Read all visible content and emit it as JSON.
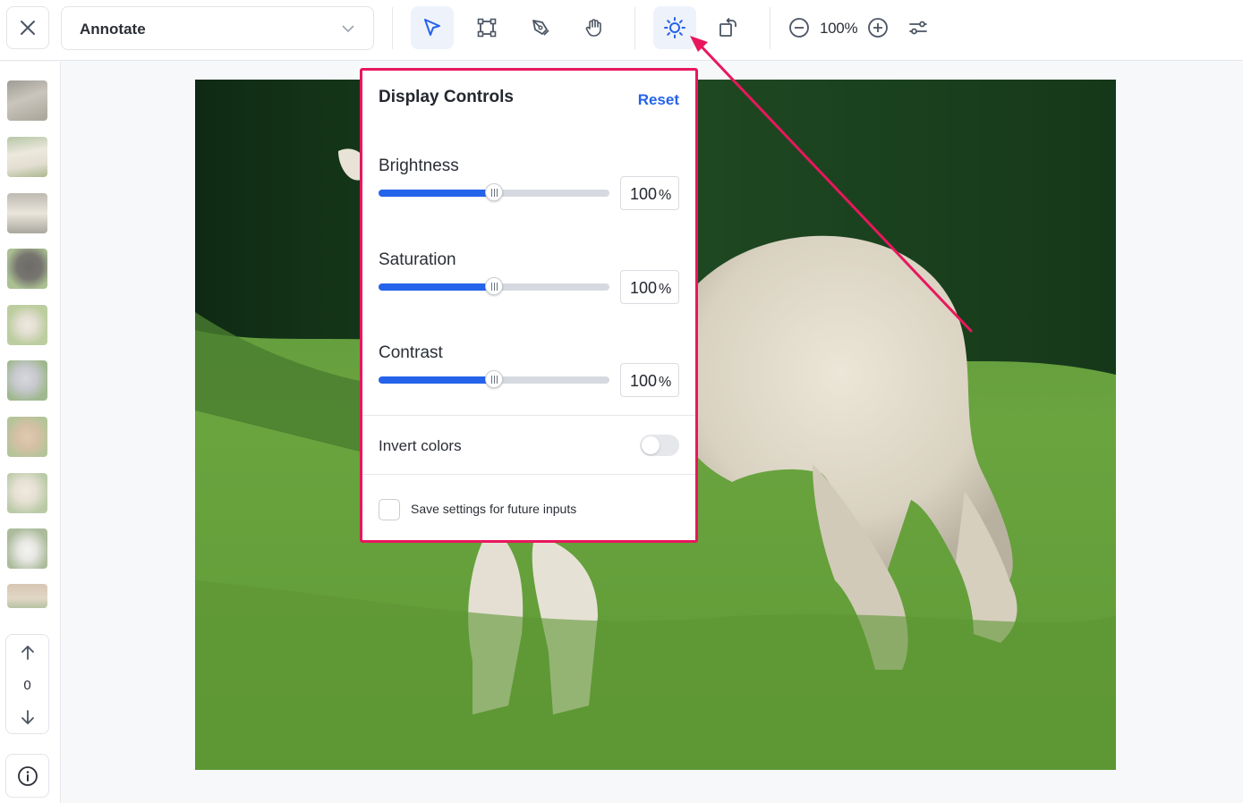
{
  "toolbar": {
    "mode_value": "Annotate",
    "zoom_level": "100%",
    "icons": [
      "close-icon",
      "chevron-down-icon",
      "pointer-icon",
      "bounding-box-icon",
      "pen-icon",
      "hand-icon",
      "brightness-icon",
      "rotate-icon",
      "zoom-out-icon",
      "zoom-in-icon",
      "settings-sliders-icon"
    ],
    "active_tool": "pointer",
    "active_button": "display-controls"
  },
  "sidebar": {
    "thumbnail_count": 10,
    "nav_index": "0",
    "icons": [
      "arrow-up-icon",
      "arrow-down-icon",
      "info-icon"
    ]
  },
  "display_controls": {
    "title": "Display Controls",
    "reset_label": "Reset",
    "controls": [
      {
        "label": "Brightness",
        "value": "100",
        "unit": "%",
        "level": 0.5
      },
      {
        "label": "Saturation",
        "value": "100",
        "unit": "%",
        "level": 0.5
      },
      {
        "label": "Contrast",
        "value": "100",
        "unit": "%",
        "level": 0.5
      }
    ],
    "invert_label": "Invert colors",
    "invert_on": false,
    "save_label": "Save settings for future inputs",
    "save_checked": false
  },
  "colors": {
    "accent": "#2563eb",
    "highlight": "#e8175d",
    "active_bg": "#eef2fb"
  }
}
